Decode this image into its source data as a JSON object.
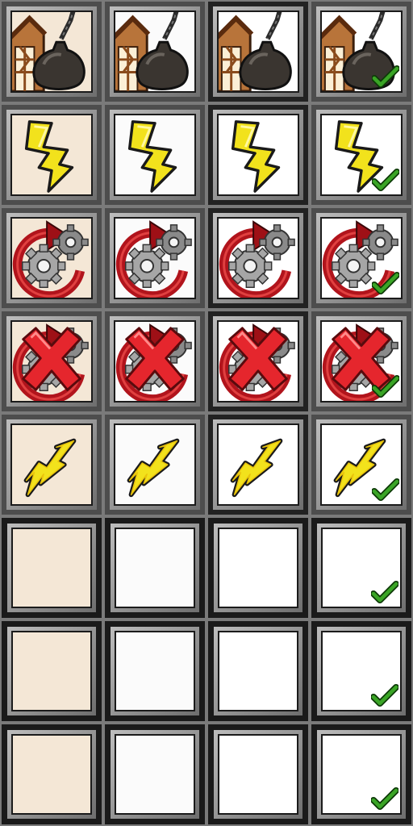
{
  "sheet": {
    "columns": [
      {
        "state": "normal"
      },
      {
        "state": "hover"
      },
      {
        "state": "pressed"
      },
      {
        "state": "selected",
        "checkmark": true
      }
    ],
    "rows": [
      {
        "icon": "wrecking-ball-house-icon"
      },
      {
        "icon": "lightning-bolt-icon"
      },
      {
        "icon": "gear-cycle-icon"
      },
      {
        "icon": "gear-cycle-cancel-icon"
      },
      {
        "icon": "small-lightning-bolt-icon"
      },
      {
        "icon": "empty"
      },
      {
        "icon": "empty"
      },
      {
        "icon": "empty"
      }
    ]
  },
  "colors": {
    "frame": "#4d4d4d",
    "normal_bg": "#f4e7d6",
    "bolt_yellow": "#f2e21c",
    "bolt_outline": "#1a1a1a",
    "gear_red": "#b1141c",
    "gear_grey": "#9a9a9a",
    "cancel_red": "#e5262d",
    "check_green": "#2f8a1e"
  }
}
